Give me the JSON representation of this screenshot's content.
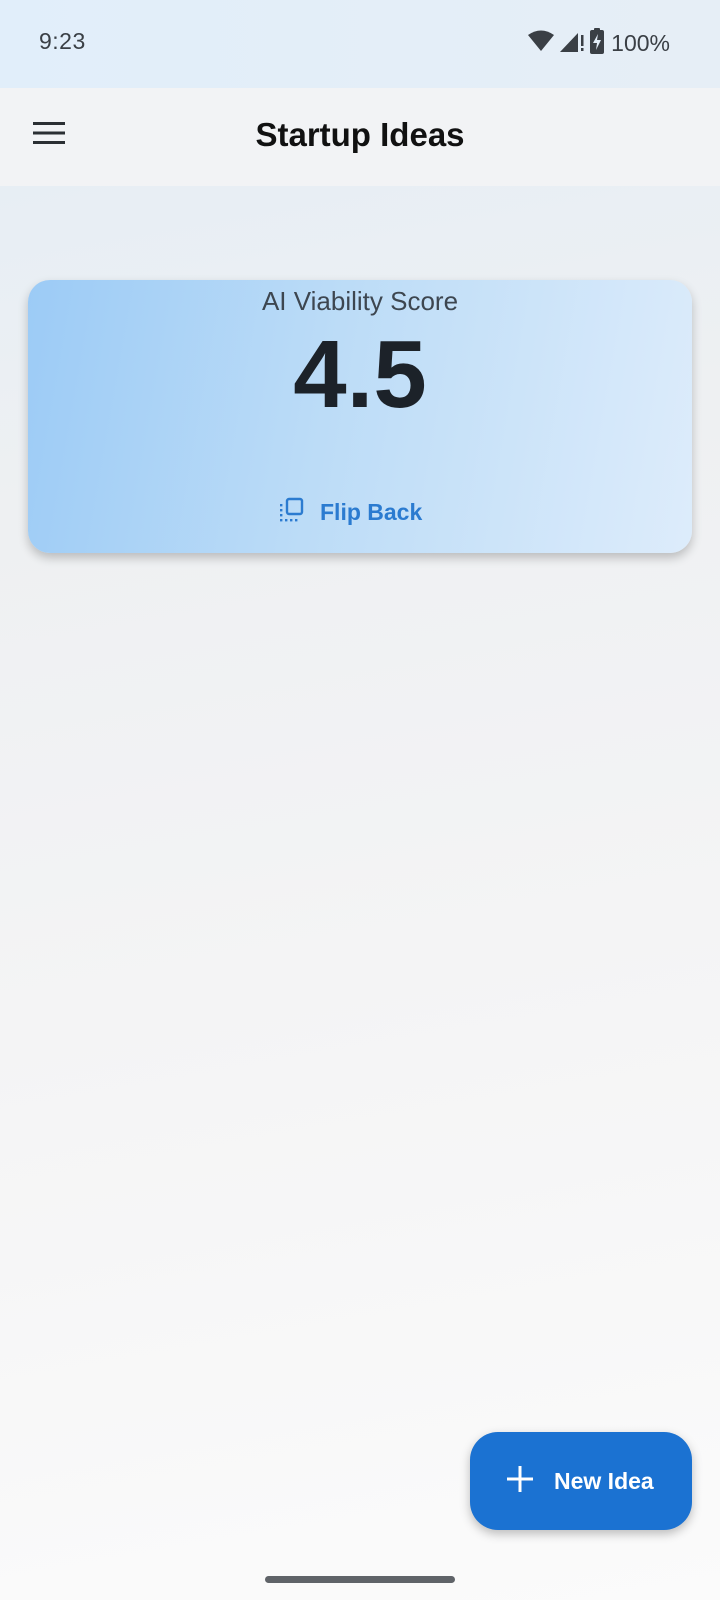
{
  "status_bar": {
    "time": "9:23",
    "battery": "100%",
    "icons": [
      "wifi-icon",
      "signal-icon",
      "battery-charging-icon"
    ]
  },
  "app_bar": {
    "title": "Startup Ideas",
    "menu_icon": "menu-icon"
  },
  "score_card": {
    "label": "AI Viability Score",
    "value": "4.5",
    "flip_back_label": "Flip Back",
    "flip_icon": "flip-icon"
  },
  "fab": {
    "label": "New Idea",
    "icon": "add-icon"
  },
  "colors": {
    "accent": "#1b72d2",
    "link": "#2b7bd0",
    "card_gradient_start": "#9ccbf6",
    "card_gradient_end": "#ddecfb"
  }
}
